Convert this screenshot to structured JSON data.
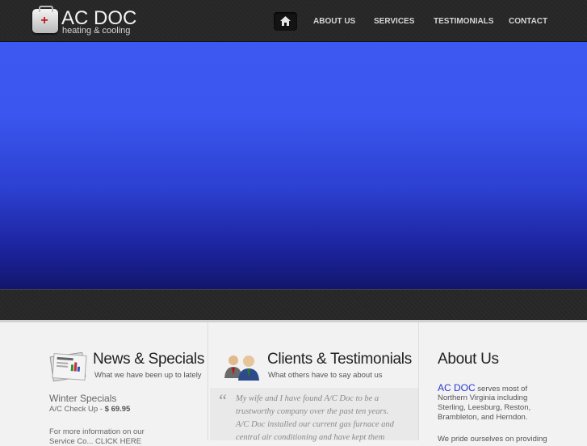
{
  "header": {
    "logo_title": "AC DOC",
    "logo_sub": "heating & cooling",
    "nav": [
      "ABOUT US",
      "SERVICES",
      "TESTIMONIALS",
      "CONTACT"
    ]
  },
  "news": {
    "title": "News & Specials",
    "subtitle": "What we have been up to lately",
    "special_title": "Winter Specials",
    "special_item": "A/C Check Up - ",
    "special_price": "$ 69.95",
    "more_line": "For more information on our",
    "cut_line": "Service Co... CLICK HERE"
  },
  "clients": {
    "title": "Clients & Testimonials",
    "subtitle": "What others have to say about us",
    "quote_lines": [
      "My wife and I have found A/C Doc to be a",
      "trustworthy company over the past ten years.",
      "A/C Doc installed our current gas furnace and",
      "central air conditioning and have kept them"
    ]
  },
  "about": {
    "title": "About Us",
    "brand": "AC DOC",
    "line1_rest": " serves most of",
    "lines": [
      "Northern Virginia including",
      "Sterling, Leesburg, Reston,",
      "Brambleton, and Herndon."
    ],
    "cut_line": "We pride ourselves on providing"
  },
  "colors": {
    "accent": "#2a37d1",
    "banner": "#3a56ee",
    "header": "#282828"
  }
}
